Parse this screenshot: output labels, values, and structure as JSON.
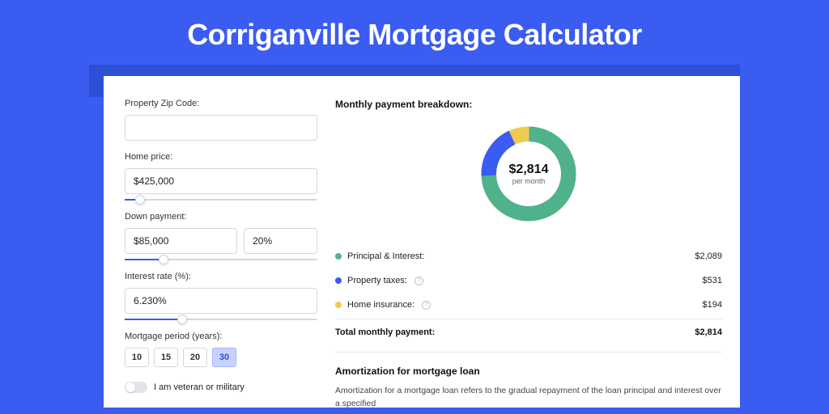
{
  "title": "Corriganville Mortgage Calculator",
  "form": {
    "zip_label": "Property Zip Code:",
    "zip_value": "",
    "home_price_label": "Home price:",
    "home_price_value": "$425,000",
    "home_price_slider_pct": 8,
    "down_payment_label": "Down payment:",
    "down_payment_value": "$85,000",
    "down_payment_pct_value": "20%",
    "down_payment_slider_pct": 20,
    "interest_label": "Interest rate (%):",
    "interest_value": "6.230%",
    "interest_slider_pct": 30,
    "period_label": "Mortgage period (years):",
    "period_options": [
      "10",
      "15",
      "20",
      "30"
    ],
    "period_selected": "30",
    "veteran_label": "I am veteran or military"
  },
  "breakdown": {
    "title": "Monthly payment breakdown:",
    "center_amount": "$2,814",
    "center_sub": "per month",
    "principal_label": "Principal & Interest:",
    "principal_value": "$2,089",
    "taxes_label": "Property taxes:",
    "taxes_value": "$531",
    "insurance_label": "Home insurance:",
    "insurance_value": "$194",
    "total_label": "Total monthly payment:",
    "total_value": "$2,814"
  },
  "amortization": {
    "title": "Amortization for mortgage loan",
    "text": "Amortization for a mortgage loan refers to the gradual repayment of the loan principal and interest over a specified"
  },
  "colors": {
    "green": "#4fb28a",
    "blue": "#3a5cf0",
    "yellow": "#f0c94f"
  },
  "chart_data": {
    "type": "pie",
    "title": "Monthly payment breakdown",
    "series": [
      {
        "name": "Principal & Interest",
        "value": 2089,
        "color": "#4fb28a"
      },
      {
        "name": "Property taxes",
        "value": 531,
        "color": "#3a5cf0"
      },
      {
        "name": "Home insurance",
        "value": 194,
        "color": "#f0c94f"
      }
    ],
    "total": 2814
  }
}
